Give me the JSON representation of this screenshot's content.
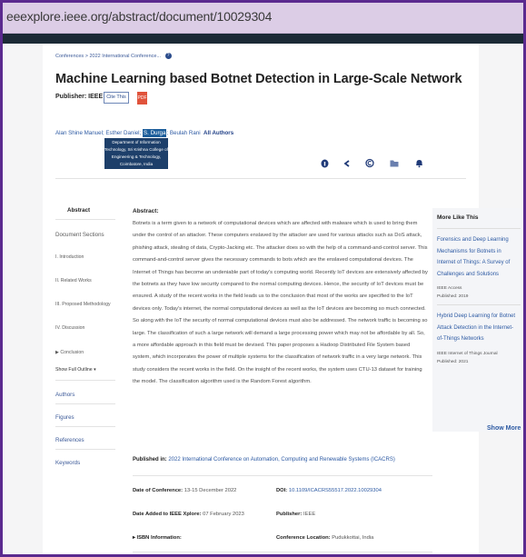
{
  "browser": {
    "url": "eeexplore.ieee.org/abstract/document/10029304"
  },
  "breadcrumb": {
    "item1": "Conferences",
    "sep": ">",
    "item2": "2022 International Conference...",
    "info": "?"
  },
  "article": {
    "title": "Machine Learning based Botnet Detection in Large-Scale Network",
    "publisher_label": "Publisher: IEEE",
    "cite_button": "Cite This",
    "pdf_button": "PDF"
  },
  "authors": {
    "list": [
      "Alan Shine Manuel;",
      "Esther Daniel;",
      "S. Durga",
      "; Beulah Rani"
    ],
    "all_authors": "All Authors",
    "tooltip": "Department of Information Technology, Sri Krishna College of Engineering & Technology, Coimbatore, India"
  },
  "toolbar_icons": [
    "info-icon",
    "share-icon",
    "copyright-icon",
    "folder-icon",
    "bell-icon"
  ],
  "sidebar": {
    "abstract": "Abstract",
    "document_sections": "Document Sections",
    "sections": [
      "I. Introduction",
      "II. Related Works",
      "III. Proposed Methodology",
      "IV. Discussion",
      "▶ Conclusion"
    ],
    "show_full_outline": "Show Full Outline ▾",
    "authors": "Authors",
    "figures": "Figures",
    "references": "References",
    "keywords": "Keywords"
  },
  "abstract": {
    "heading": "Abstract:",
    "lines": [
      "Botnets is a term given to a network of computational devices which are affected with malware which is used to bring them",
      "under the control of an attacker. These computers enslaved by the attacker are used for various attacks such as DoS attack,",
      "phishing attack, stealing of data, Crypto-Jacking etc. The attacker does so with the help of a command-and-control server. This",
      "command-and-control server gives the necessary commands to bots which are the enslaved computational devices. The",
      "Internet of Things has become an undeniable part of today's computing world. Recently IoT devices are extensively affected by",
      "the botnets as they have low security compared to the normal computing devices. Hence, the security of IoT devices must be",
      "ensured. A study of the recent works in the field leads us to the conclusion that most of the works are specified to the IoT",
      "devices only. Today's internet, the normal computational devices as well as the IoT devices are becoming so much connected.",
      "So along with the IoT the security of normal computational devices must also be addressed. The network traffic is becoming so",
      "large. The classification of such a large network will demand a large processing power which may not be affordable by all. So,",
      "a more affordable approach in this field must be devised. This paper proposes a Hadoop Distributed File System based",
      "system, which incorporates the power of multiple systems for the classification of network traffic in a very large network. This",
      "study considers the recent works in the field. On the insight of the recent works, the system uses CTU-13 dataset for training",
      "the model. The classification algorithm used is the Random Forest algorithm."
    ]
  },
  "more_like_this": {
    "heading": "More Like This",
    "items": [
      {
        "title_lines": [
          "Forensics and Deep Learning",
          "Mechanisms for Botnets in",
          "Internet of Things: A Survey of",
          "Challenges and Solutions"
        ],
        "source": "IEEE Access",
        "published": "Published: 2019"
      },
      {
        "title_lines": [
          "Hybrid Deep Learning for Botnet",
          "Attack Detection in the Internet-",
          "of-Things Networks"
        ],
        "source": "IEEE Internet of Things Journal",
        "published": "Published: 2021"
      }
    ],
    "show_more": "Show More"
  },
  "published_in": {
    "label": "Published in:",
    "value": "2022 International Conference on Automation, Computing and Renewable Systems (ICACRS)"
  },
  "meta": {
    "date_conf_label": "Date of Conference:",
    "date_conf_value": "13-15 December 2022",
    "doi_label": "DOI:",
    "doi_value": "10.1109/ICACRS55517.2022.10029304",
    "date_added_label": "Date Added to IEEE Xplore:",
    "date_added_value": "07 February 2023",
    "publisher_label": "Publisher:",
    "publisher_value": "IEEE",
    "isbn_label": "▸ ISBN Information:",
    "conf_loc_label": "Conference Location:",
    "conf_loc_value": "Pudukkottai, India"
  }
}
